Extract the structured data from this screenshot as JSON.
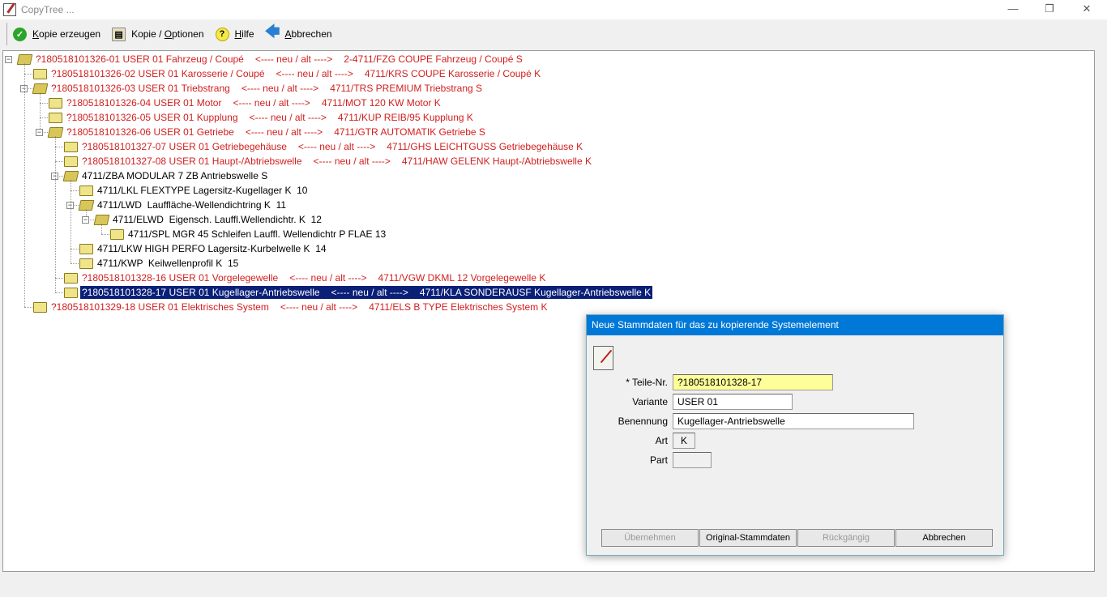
{
  "window": {
    "title": "CopyTree ...",
    "minimize": "—",
    "restore": "❐",
    "close": "✕"
  },
  "toolbar": {
    "create": {
      "key": "K",
      "rest": "opie erzeugen"
    },
    "options": {
      "pre": "Kopie / ",
      "key": "O",
      "rest": "ptionen"
    },
    "help": {
      "key": "H",
      "rest": "ilfe"
    },
    "cancel": {
      "key": "A",
      "rest": "bbrechen"
    }
  },
  "tree": {
    "separator": "<---- neu / alt ---->",
    "rows": [
      {
        "level": 0,
        "expandable": true,
        "red": true,
        "text": "?180518101326-01 USER 01 Fahrzeug / Coupé",
        "old": "2-4711/FZG COUPE Fahrzeug / Coupé S"
      },
      {
        "level": 1,
        "expandable": false,
        "red": true,
        "text": "?180518101326-02 USER 01 Karosserie / Coupé",
        "old": "4711/KRS COUPE Karosserie / Coupé K"
      },
      {
        "level": 1,
        "expandable": true,
        "red": true,
        "text": "?180518101326-03 USER 01 Triebstrang",
        "old": "4711/TRS PREMIUM Triebstrang S"
      },
      {
        "level": 2,
        "expandable": false,
        "red": true,
        "text": "?180518101326-04 USER 01 Motor",
        "old": "4711/MOT 120 KW Motor K"
      },
      {
        "level": 2,
        "expandable": false,
        "red": true,
        "text": "?180518101326-05 USER 01 Kupplung",
        "old": "4711/KUP REIB/95 Kupplung K"
      },
      {
        "level": 2,
        "expandable": true,
        "red": true,
        "text": "?180518101326-06 USER 01 Getriebe",
        "old": "4711/GTR AUTOMATIK Getriebe S"
      },
      {
        "level": 3,
        "expandable": false,
        "red": true,
        "text": "?180518101327-07 USER 01 Getriebegehäuse",
        "old": "4711/GHS LEICHTGUSS Getriebegehäuse K"
      },
      {
        "level": 3,
        "expandable": false,
        "red": true,
        "text": "?180518101327-08 USER 01 Haupt-/Abtriebswelle",
        "old": "4711/HAW GELENK Haupt-/Abtriebswelle K"
      },
      {
        "level": 3,
        "expandable": true,
        "red": false,
        "text": "4711/ZBA MODULAR 7 ZB Antriebswelle S"
      },
      {
        "level": 4,
        "expandable": false,
        "red": false,
        "text": "4711/LKL FLEXTYPE Lagersitz-Kugellager K  10"
      },
      {
        "level": 4,
        "expandable": true,
        "red": false,
        "text": "4711/LWD  Lauffläche-Wellendichtring K  11"
      },
      {
        "level": 5,
        "expandable": true,
        "red": false,
        "text": "4711/ELWD  Eigensch. Lauffl.Wellendichtr. K  12"
      },
      {
        "level": 6,
        "expandable": false,
        "red": false,
        "text": "4711/SPL MGR 45 Schleifen Lauffl. Wellendichtr P FLAE 13"
      },
      {
        "level": 4,
        "expandable": false,
        "red": false,
        "text": "4711/LKW HIGH PERFO Lagersitz-Kurbelwelle K  14"
      },
      {
        "level": 4,
        "expandable": false,
        "red": false,
        "text": "4711/KWP  Keilwellenprofil K  15"
      },
      {
        "level": 3,
        "expandable": false,
        "red": true,
        "text": "?180518101328-16 USER 01 Vorgelegewelle",
        "old": "4711/VGW DKML 12 Vorgelegewelle K"
      },
      {
        "level": 3,
        "expandable": false,
        "red": true,
        "selected": true,
        "text": "?180518101328-17 USER 01 Kugellager-Antriebswelle",
        "old": "4711/KLA SONDERAUSF Kugellager-Antriebswelle K"
      },
      {
        "level": 1,
        "expandable": false,
        "red": true,
        "text": "?180518101329-18 USER 01 Elektrisches System",
        "old": "4711/ELS B TYPE Elektrisches System K"
      }
    ]
  },
  "dialog": {
    "title": "Neue Stammdaten für das zu kopierende Systemelement",
    "fields": {
      "teile_nr": {
        "label": "* Teile-Nr.",
        "value": "?180518101328-17"
      },
      "variante": {
        "label": "Variante",
        "value": "USER 01"
      },
      "benennung": {
        "label": "Benennung",
        "value": "Kugellager-Antriebswelle"
      },
      "art": {
        "label": "Art",
        "value": "K"
      },
      "part": {
        "label": "Part",
        "value": ""
      }
    },
    "buttons": {
      "apply": "Übernehmen",
      "original": "Original-Stammdaten",
      "undo": "Rückgängig",
      "cancel": "Abbrechen"
    }
  },
  "colors": {
    "accent": "#0078d7",
    "red_text": "#d21e1e",
    "selection": "#0a1f78",
    "required_field": "#ffff99"
  }
}
